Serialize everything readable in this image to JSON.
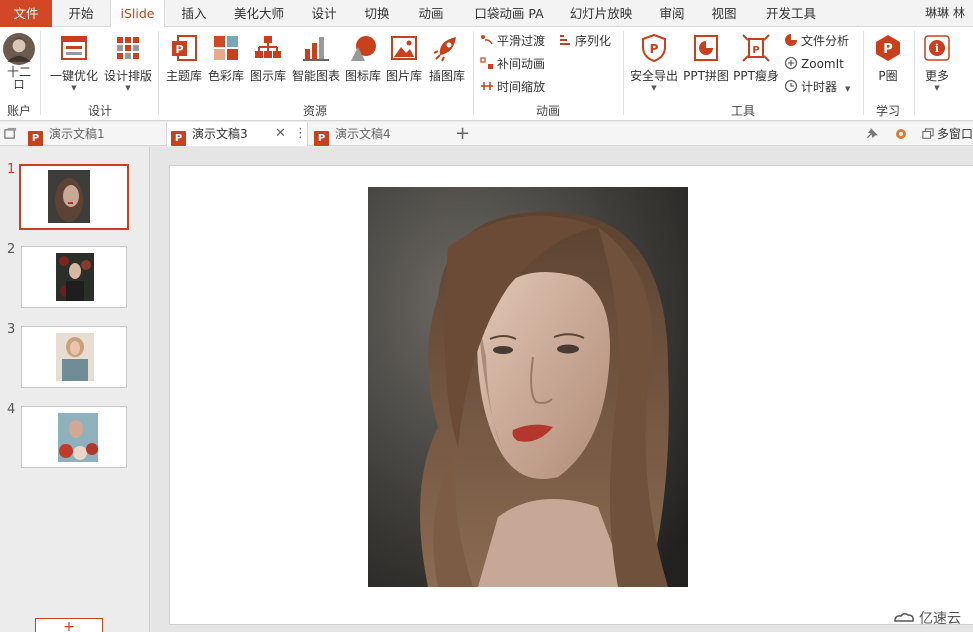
{
  "tabs": {
    "file": "文件",
    "items": [
      "开始",
      "iSlide",
      "插入",
      "美化大师",
      "设计",
      "切换",
      "动画",
      "口袋动画 PA",
      "幻灯片放映",
      "审阅",
      "视图",
      "开发工具"
    ],
    "active": "iSlide",
    "user": "琳琳 林"
  },
  "ribbon": {
    "account": {
      "name": "十二",
      "sub": "口",
      "group": "账户"
    },
    "design": {
      "group": "设计",
      "one_click": "一键优化",
      "layout": "设计排版"
    },
    "resources": {
      "group": "资源",
      "items": [
        "主题库",
        "色彩库",
        "图示库",
        "智能图表",
        "图标库",
        "图片库",
        "插图库"
      ]
    },
    "animation": {
      "group": "动画",
      "smooth": "平滑过渡",
      "sequence": "序列化",
      "tween": "补间动画",
      "timescale": "时间缩放"
    },
    "tools": {
      "group": "工具",
      "safe_export": "安全导出",
      "ppt_collage": "PPT拼图",
      "ppt_slim": "PPT瘦身",
      "file_analysis": "文件分析",
      "zoomit": "ZoomIt",
      "timer": "计时器"
    },
    "learn": {
      "group": "学习",
      "p_circle": "P圈"
    },
    "more": {
      "label": "更多"
    }
  },
  "doc_tabs": {
    "items": [
      "演示文稿1",
      "演示文稿3",
      "演示文稿4"
    ],
    "active": "演示文稿3",
    "window_label": "多窗口"
  },
  "slides": {
    "numbers": [
      "1",
      "2",
      "3",
      "4"
    ],
    "active": 1,
    "add_label": "+"
  },
  "watermark": "亿速云",
  "colors": {
    "accent": "#c8401c",
    "file_tab": "#d24726"
  }
}
